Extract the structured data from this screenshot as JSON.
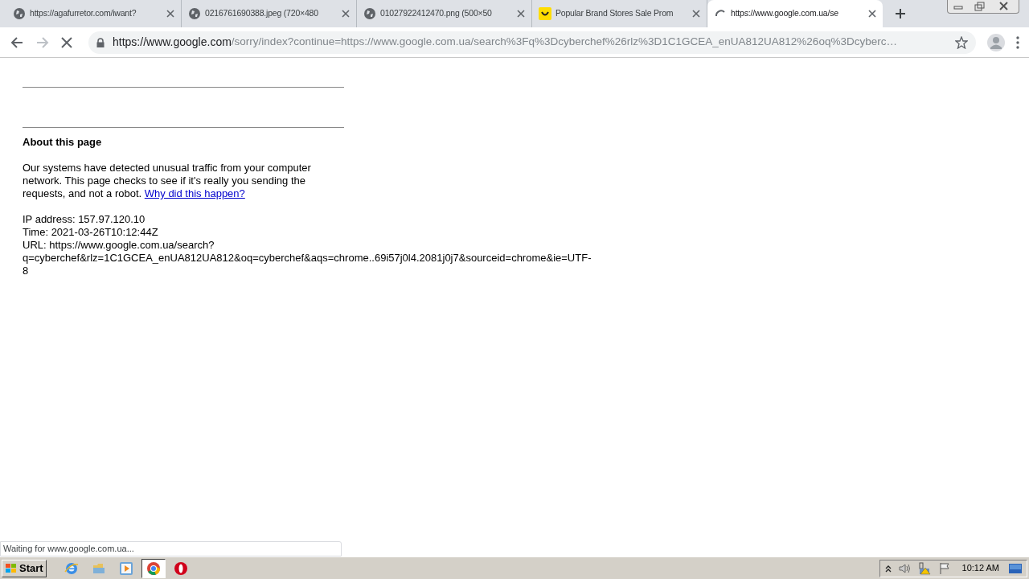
{
  "tabs": [
    {
      "title": "https://agafurretor.com/iwant?",
      "kind": "globe",
      "selected": false
    },
    {
      "title": "0216761690388.jpeg (720×480",
      "kind": "globe",
      "selected": false
    },
    {
      "title": "01027922412470.png (500×50",
      "kind": "globe",
      "selected": false
    },
    {
      "title": "Popular Brand Stores Sale Prom",
      "kind": "smile",
      "selected": false
    },
    {
      "title": "https://www.google.com.ua/se",
      "kind": "spinner",
      "selected": true
    }
  ],
  "address_bar": {
    "host": "https://www.google.com",
    "rest": "/sorry/index?continue=https://www.google.com.ua/search%3Fq%3Dcyberchef%26rlz%3D1C1GCEA_enUA812UA812%26oq%3Dcyberc…",
    "loading": true
  },
  "page": {
    "heading": "About this page",
    "paragraph": "Our systems have detected unusual traffic from your computer network. This page checks to see if it's really you sending the requests, and not a robot.",
    "link": "Why did this happen?",
    "ip": "IP address: 157.97.120.10",
    "time": "Time: 2021-03-26T10:12:44Z",
    "url": "URL: https://www.google.com.ua/search?q=cyberchef&rlz=1C1GCEA_enUA812UA812&oq=cyberchef&aqs=chrome..69i57j0l4.2081j0j7&sourceid=chrome&ie=UTF-8"
  },
  "status_bubble": "Waiting for www.google.com.ua...",
  "taskbar": {
    "start": "Start",
    "apps": [
      {
        "kind": "ie",
        "selected": false
      },
      {
        "kind": "folder",
        "selected": false
      },
      {
        "kind": "media",
        "selected": false
      },
      {
        "kind": "chrome",
        "selected": true
      },
      {
        "kind": "opera",
        "selected": false
      }
    ],
    "clock": "10:12 AM"
  }
}
